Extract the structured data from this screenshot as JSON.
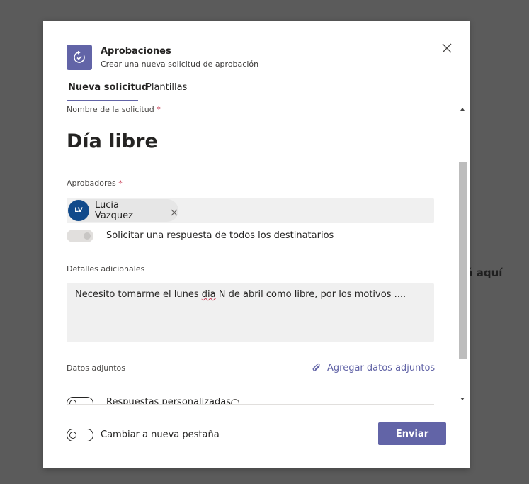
{
  "background": {
    "partial_text": "rá aquí"
  },
  "header": {
    "app_name": "Aprobaciones",
    "subtitle": "Crear una nueva solicitud de aprobación"
  },
  "tabs": [
    {
      "label": "Nueva solicitud",
      "active": true
    },
    {
      "label": "Plantillas",
      "active": false
    }
  ],
  "form": {
    "request_name_label": "Nombre de la solicitud",
    "request_name_value": "Día libre",
    "required_marker": "*",
    "approvers_label": "Aprobadores",
    "approvers": [
      {
        "initials": "LV",
        "name": "Lucia Vazquez"
      }
    ],
    "all_responses_toggle": {
      "label": "Solicitar una respuesta de todos los destinatarios",
      "on": false,
      "disabled": true
    },
    "details_label": "Detalles adicionales",
    "details_value": {
      "before": "Necesito tomarme el lunes ",
      "misspelled": "dia",
      "after": " N de abril como libre, por los motivos ...."
    },
    "attachments_label": "Datos adjuntos",
    "add_attachments_link": "Agregar datos adjuntos",
    "custom_responses_label": "Respuestas personalizadas"
  },
  "footer": {
    "new_tab_toggle_label": "Cambiar a nueva pestaña",
    "new_tab_toggle_on": false,
    "send_button": "Enviar"
  },
  "colors": {
    "accent": "#6264a7",
    "avatar": "#114a8b",
    "required": "#c4314b"
  }
}
